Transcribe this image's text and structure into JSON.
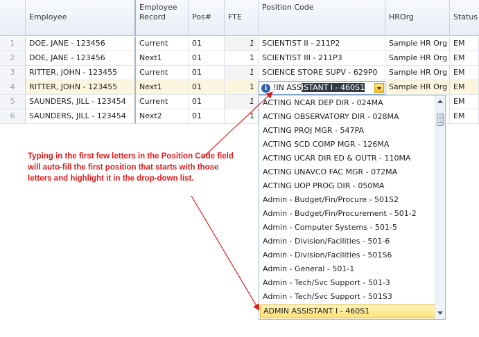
{
  "grid": {
    "columns": [
      {
        "key": "num",
        "label": ""
      },
      {
        "key": "employee",
        "label": "Employee"
      },
      {
        "key": "record",
        "label": "Employee Record"
      },
      {
        "key": "pos",
        "label": "Pos#"
      },
      {
        "key": "fte",
        "label": "FTE"
      },
      {
        "key": "position_code",
        "label": "Position Code"
      },
      {
        "key": "hrorg",
        "label": "HROrg"
      },
      {
        "key": "status",
        "label": "Status"
      }
    ],
    "rows": [
      {
        "num": "1",
        "employee": "DOE, JANE - 123456",
        "record": "Current",
        "pos": "01",
        "fte": "1",
        "position_code": "SCIENTIST II - 211P2",
        "hrorg": "Sample HR Org",
        "status": "EM"
      },
      {
        "num": "2",
        "employee": "DOE, JANE - 123456",
        "record": "Next1",
        "pos": "01",
        "fte": "1",
        "position_code": "SCIENTIST III - 211P3",
        "hrorg": "Sample HR Org",
        "status": "EM"
      },
      {
        "num": "3",
        "employee": "RITTER, JOHN - 123455",
        "record": "Current",
        "pos": "01",
        "fte": "1",
        "position_code": "SCIENCE STORE SUPV - 629P0",
        "hrorg": "Sample HR Org",
        "status": "EM"
      },
      {
        "num": "4",
        "employee": "RITTER, JOHN - 123455",
        "record": "Next1",
        "pos": "01",
        "fte": "1",
        "position_code": "",
        "hrorg": "Sample HR Org",
        "status": "EM"
      },
      {
        "num": "5",
        "employee": "SAUNDERS, JILL - 123454",
        "record": "Current",
        "pos": "01",
        "fte": "1",
        "position_code": "",
        "hrorg": "",
        "status": "EM"
      },
      {
        "num": "6",
        "employee": "SAUNDERS, JILL - 123454",
        "record": "Next2",
        "pos": "01",
        "fte": "1",
        "position_code": "",
        "hrorg": "",
        "status": "EM"
      }
    ]
  },
  "editor": {
    "info_icon": "info-icon",
    "typed_text": "!IN ASS",
    "autofill_text": "ISTANT I - 460S1"
  },
  "dropdown": {
    "options": [
      "ACTING NCAR DEP DIR - 024MA",
      "ACTING OBSERVATORY DIR - 028MA",
      "ACTING PROJ MGR - 547PA",
      "ACTING SCD COMP MGR - 126MA",
      "ACTING UCAR DIR ED & OUTR - 110MA",
      "ACTING UNAVCO FAC MGR - 072MA",
      "ACTING UOP PROG DIR - 050MA",
      "Admin - Budget/Fin/Procure - 501S2",
      "Admin - Budget/Fin/Procurement - 501-2",
      "Admin - Computer Systems - 501-5",
      "Admin - Division/Facilities - 501-6",
      "Admin - Division/Facilities - 501S6",
      "Admin - General - 501-1",
      "Admin - Tech/Svc Support - 501-3",
      "Admin - Tech/Svc Support - 501S3",
      "ADMIN ASSISTANT I - 460S1"
    ],
    "highlighted_index": 15
  },
  "annotation": {
    "text": "Typing in the first few letters in the Position Code field will auto-fill the first position that starts with those letters and highlight it in the drop-down list.",
    "color": "#e01919"
  }
}
